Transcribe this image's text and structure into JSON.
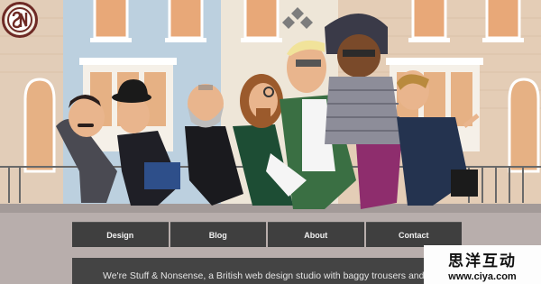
{
  "brand": {
    "logo_text": "S&N",
    "accent": "#6e2a25"
  },
  "nav": {
    "items": [
      {
        "label": "Design",
        "name": "nav-design"
      },
      {
        "label": "Blog",
        "name": "nav-blog"
      },
      {
        "label": "About",
        "name": "nav-about"
      },
      {
        "label": "Contact",
        "name": "nav-contact"
      }
    ]
  },
  "intro": {
    "text": "We're Stuff & Nonsense, a British web design studio with baggy trousers and"
  },
  "watermark": {
    "chinese": "思洋互动",
    "url": "www.ciya.com"
  },
  "colors": {
    "nav_bg": "#3f3f3f",
    "page_bg": "#b8aeac",
    "intro_bg": "#444444"
  }
}
